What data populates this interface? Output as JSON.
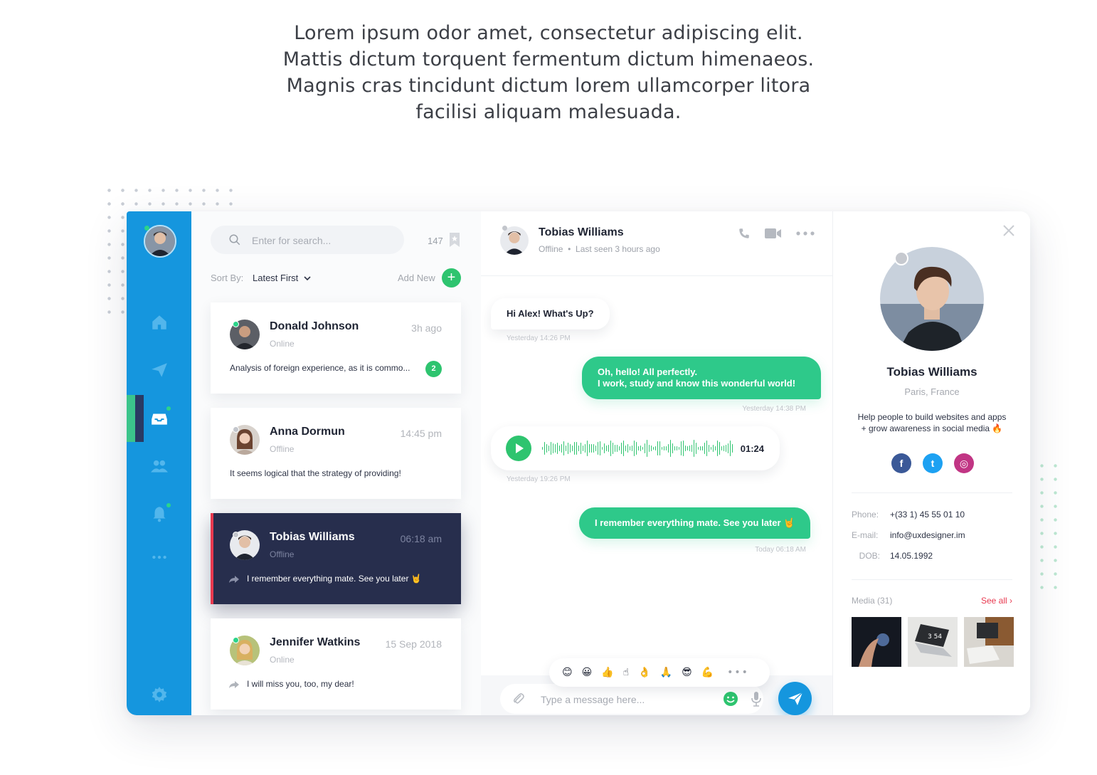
{
  "intro": {
    "lines": [
      "Lorem ipsum odor amet, consectetur adipiscing elit.",
      "Mattis dictum torquent fermentum dictum himenaeos.",
      "Magnis cras tincidunt dictum lorem ullamcorper litora",
      "facilisi aliquam malesuada."
    ]
  },
  "colors": {
    "rail": "#1596de",
    "accent_green": "#2ec98a",
    "active_card": "#272e4d",
    "alert_red": "#e8394f"
  },
  "nav": {
    "items": [
      "home-icon",
      "send-icon",
      "inbox-icon",
      "contacts-icon",
      "bell-icon",
      "more-icon"
    ],
    "bottom": "gear-icon"
  },
  "list": {
    "search_placeholder": "Enter for search...",
    "count": "147",
    "sort_label": "Sort By:",
    "sort_value": "Latest First",
    "add_new": "Add New",
    "add_icon": "+",
    "conversations": [
      {
        "name": "Donald Johnson",
        "time": "3h ago",
        "status": "Online",
        "message": "Analysis of foreign experience, as it is commo...",
        "unread": "2"
      },
      {
        "name": "Anna Dormun",
        "time": "14:45 pm",
        "status": "Offline",
        "message": "It seems logical that the strategy of providing!"
      },
      {
        "name": "Tobias Williams",
        "time": "06:18 am",
        "status": "Offline",
        "message": "I remember everything mate. See you later 🤘"
      },
      {
        "name": "Jennifer Watkins",
        "time": "15 Sep 2018",
        "status": "Online",
        "message": "I will miss you, too, my dear!"
      }
    ]
  },
  "chat": {
    "name": "Tobias Williams",
    "status": "Offline",
    "last_seen": "Last seen 3 hours ago",
    "messages": [
      {
        "text": "Hi Alex! What's Up?",
        "time": "Yesterday 14:26 PM"
      },
      {
        "text_line1": "Oh, hello! All perfectly.",
        "text_line2": "I work, study and know this wonderful world!",
        "time": "Yesterday 14:38 PM"
      },
      {
        "duration": "01:24",
        "time": "Yesterday 19:26 PM"
      },
      {
        "text": "I remember everything mate. See you later 🤘",
        "time": "Today 06:18 AM"
      }
    ],
    "emojis": [
      "😊",
      "😀",
      "👍",
      "☝",
      "👌",
      "🙏",
      "😎",
      "💪"
    ],
    "emoji_more": "•••",
    "composer_placeholder": "Type a message here..."
  },
  "profile": {
    "name": "Tobias Williams",
    "location": "Paris, France",
    "bio_line1": "Help people to build websites and apps",
    "bio_line2": "+ grow awareness in social media 🔥",
    "socials": [
      {
        "name": "facebook-icon",
        "glyph": "f",
        "color": "#3b5998"
      },
      {
        "name": "twitter-icon",
        "glyph": "t",
        "color": "#1da1f2"
      },
      {
        "name": "instagram-icon",
        "glyph": "◎",
        "color": "#c13584"
      }
    ],
    "phone_label": "Phone:",
    "phone": "+(33 1) 45 55 01 10",
    "email_label": "E-mail:",
    "email": "info@uxdesigner.im",
    "dob_label": "DOB:",
    "dob": "14.05.1992",
    "media_label": "Media (31)",
    "see_all": "See all ›"
  }
}
